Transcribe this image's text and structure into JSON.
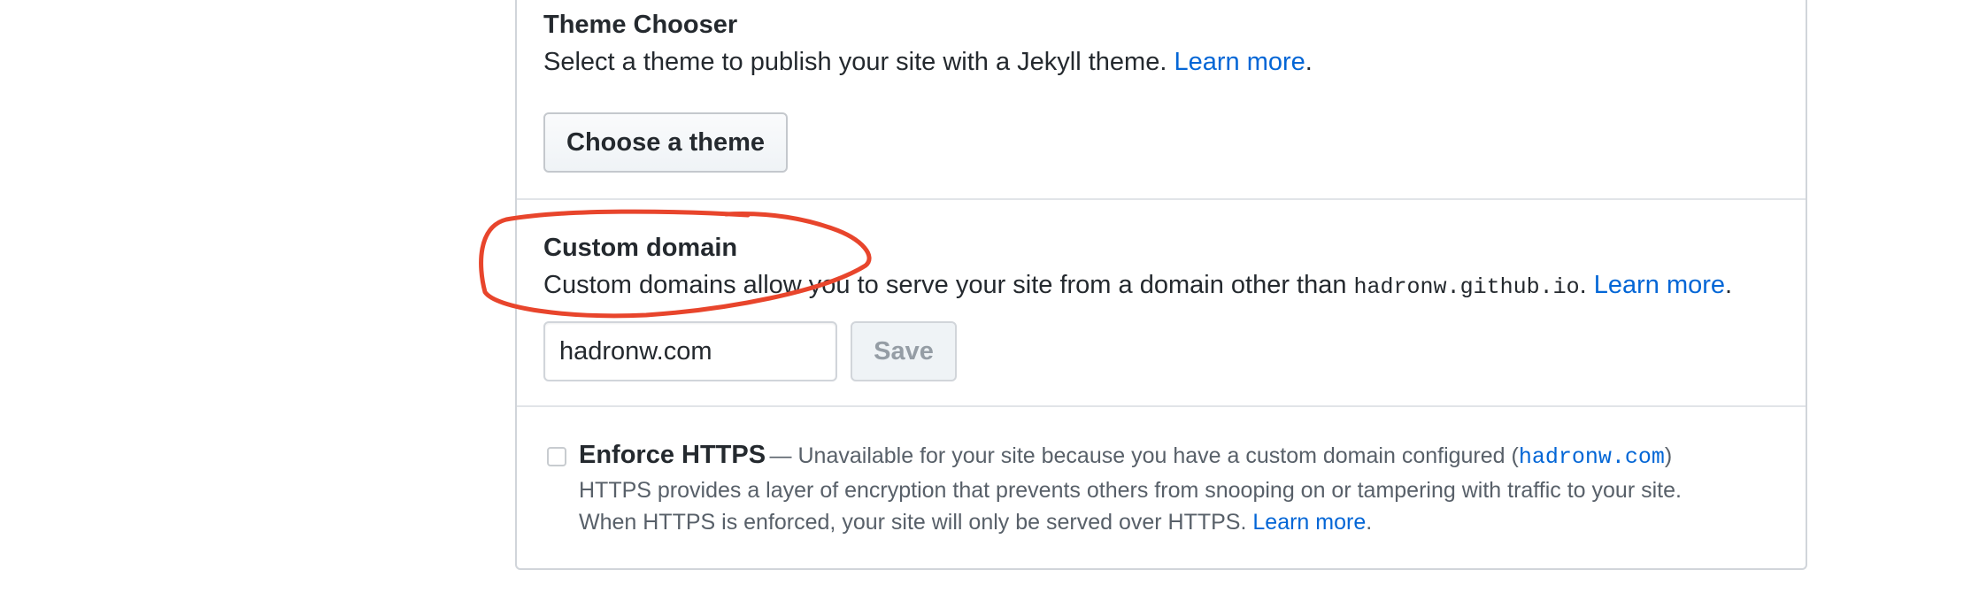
{
  "theme_chooser": {
    "title": "Theme Chooser",
    "description": "Select a theme to publish your site with a Jekyll theme.",
    "learn_more": "Learn more",
    "button_label": "Choose a theme"
  },
  "custom_domain": {
    "title": "Custom domain",
    "description_prefix": "Custom domains allow you to serve your site from a domain other than",
    "default_domain": "hadronw.github.io",
    "learn_more": "Learn more",
    "input_value": "hadronw.com",
    "save_label": "Save"
  },
  "enforce_https": {
    "title": "Enforce HTTPS",
    "unavailable_note": "— Unavailable for your site because you have a custom domain configured (",
    "configured_domain": "hadronw.com",
    "line1": "HTTPS provides a layer of encryption that prevents others from snooping on or tampering with traffic to your site.",
    "line2": "When HTTPS is enforced, your site will only be served over HTTPS.",
    "learn_more": "Learn more",
    "checked": false
  },
  "colors": {
    "link": "#0366d6",
    "annotation": "#e8452c"
  }
}
